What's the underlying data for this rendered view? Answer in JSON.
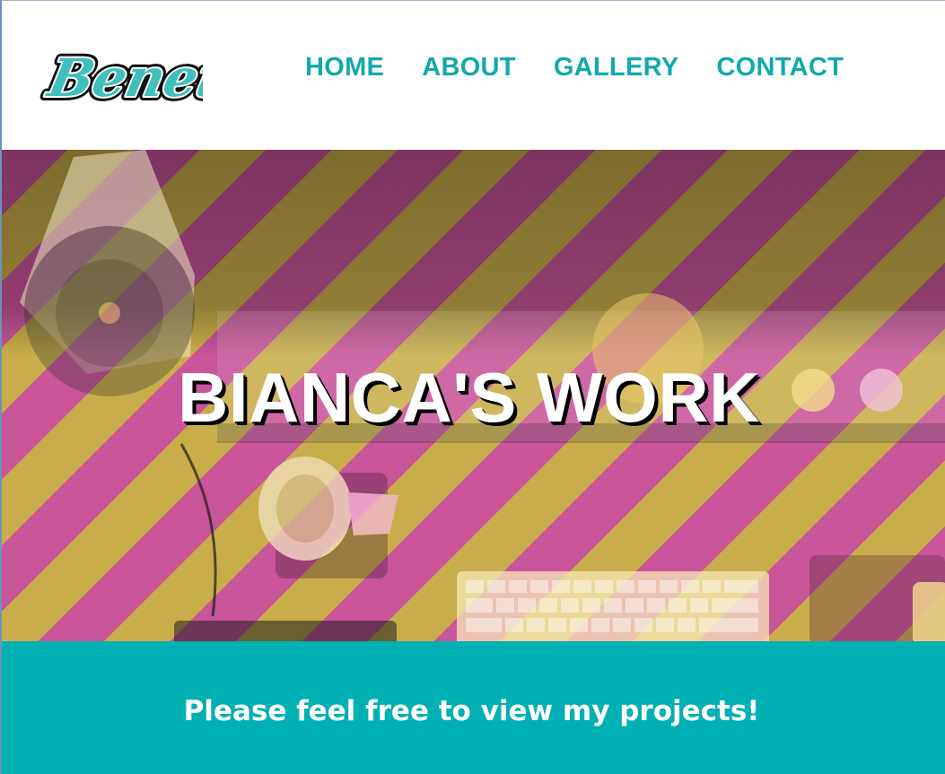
{
  "header": {
    "logo_text": "Beneth",
    "nav": [
      {
        "label": "HOME"
      },
      {
        "label": "ABOUT"
      },
      {
        "label": "GALLERY"
      },
      {
        "label": "CONTACT"
      }
    ]
  },
  "hero": {
    "title": "BIANCA'S WORK"
  },
  "banner": {
    "text": "Please feel free to view my projects!"
  },
  "colors": {
    "accent_teal": "#12a9ad",
    "banner_teal": "#00b0b3",
    "stripe_magenta": "#c24b8a",
    "stripe_mustard": "#b99a3c",
    "white": "#ffffff"
  },
  "icons": {
    "logo": "beneth-script-logo"
  }
}
